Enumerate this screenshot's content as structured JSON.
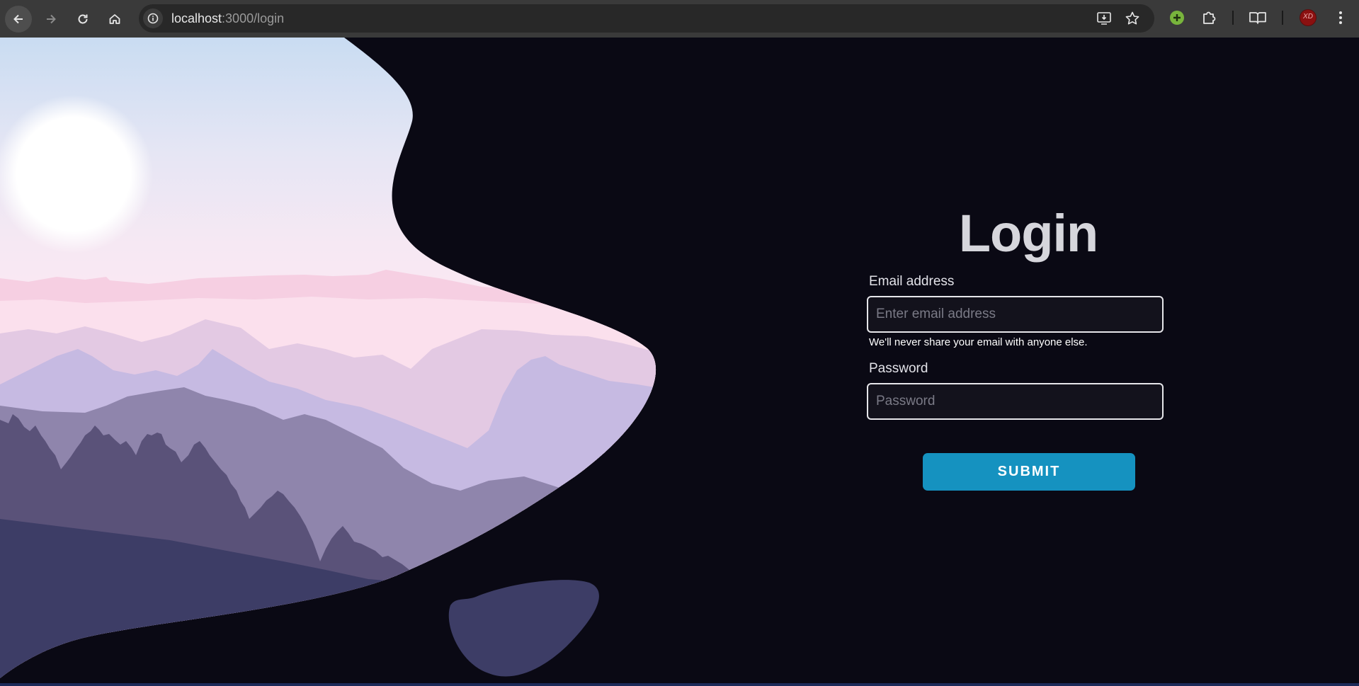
{
  "browser": {
    "url_host": "localhost",
    "url_rest": ":3000/login",
    "icons": [
      "back-icon",
      "forward-icon",
      "reload-icon",
      "home-icon",
      "site-info-icon",
      "install-app-icon",
      "bookmark-star-icon",
      "extension-green-icon",
      "extensions-puzzle-icon",
      "reading-mode-icon",
      "profile-avatar",
      "menu-dots-icon"
    ],
    "profile_initials": "XD"
  },
  "login": {
    "title": "Login",
    "email_label": "Email address",
    "email_placeholder": "Enter email address",
    "email_value": "",
    "email_help": "We'll never share your email with anyone else.",
    "password_label": "Password",
    "password_placeholder": "Password",
    "password_value": "",
    "submit_label": "SUBMIT"
  },
  "colors": {
    "page_background": "#0a0914",
    "accent_button": "#1592c0",
    "blob": "#3d3d66"
  }
}
